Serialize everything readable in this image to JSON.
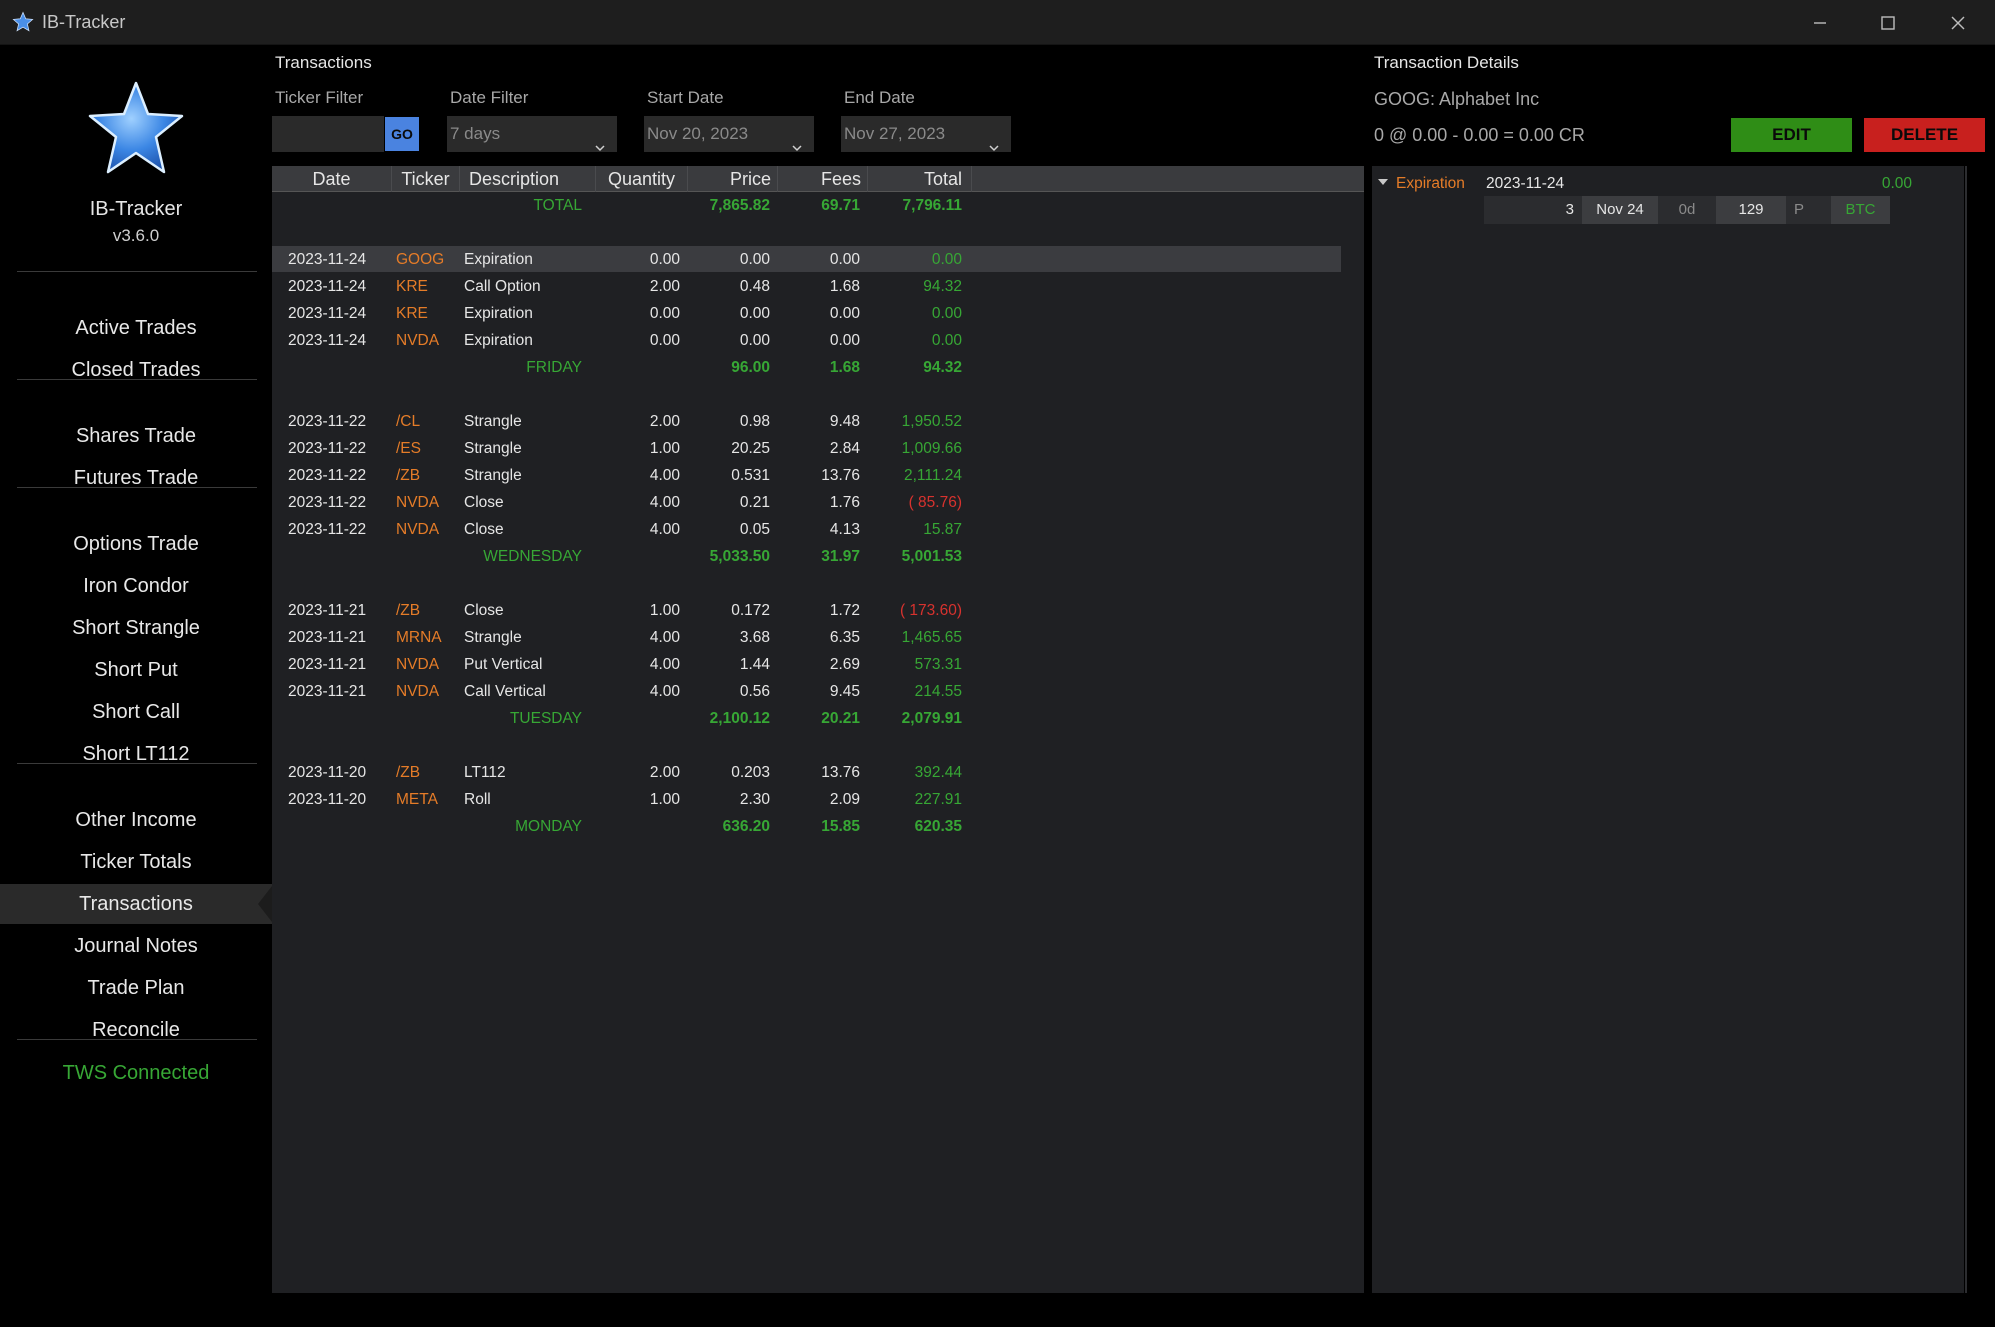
{
  "window": {
    "title": "IB-Tracker"
  },
  "sidebar": {
    "app_name": "IB-Tracker",
    "version": "v3.6.0",
    "groups": [
      [
        "Active Trades",
        "Closed Trades"
      ],
      [
        "Shares Trade",
        "Futures Trade"
      ],
      [
        "Options Trade",
        "Iron Condor",
        "Short Strangle",
        "Short Put",
        "Short Call",
        "Short LT112"
      ],
      [
        "Other Income",
        "Ticker Totals",
        "Transactions",
        "Journal Notes",
        "Trade Plan",
        "Reconcile"
      ]
    ],
    "active_item": "Transactions",
    "status": "TWS Connected"
  },
  "transactions": {
    "title": "Transactions",
    "ticker_filter": {
      "label": "Ticker Filter",
      "value": "",
      "go_label": "GO"
    },
    "date_filter": {
      "label": "Date Filter",
      "value": "7 days"
    },
    "start_date": {
      "label": "Start Date",
      "value": "Nov 20, 2023"
    },
    "end_date": {
      "label": "End Date",
      "value": "Nov 27, 2023"
    },
    "columns": [
      "Date",
      "Ticker",
      "Description",
      "Quantity",
      "Price",
      "Fees",
      "Total"
    ],
    "total_row": {
      "label": "TOTAL",
      "price": "7,865.82",
      "fees": "69.71",
      "total": "7,796.11"
    },
    "groups": [
      {
        "label": "FRIDAY",
        "price": "96.00",
        "fees": "1.68",
        "total": "94.32",
        "rows": [
          {
            "date": "2023-11-24",
            "ticker": "GOOG",
            "description": "Expiration",
            "quantity": "0.00",
            "price": "0.00",
            "fees": "0.00",
            "total": "0.00",
            "neg": false,
            "selected": true
          },
          {
            "date": "2023-11-24",
            "ticker": "KRE",
            "description": "Call Option",
            "quantity": "2.00",
            "price": "0.48",
            "fees": "1.68",
            "total": "94.32",
            "neg": false
          },
          {
            "date": "2023-11-24",
            "ticker": "KRE",
            "description": "Expiration",
            "quantity": "0.00",
            "price": "0.00",
            "fees": "0.00",
            "total": "0.00",
            "neg": false
          },
          {
            "date": "2023-11-24",
            "ticker": "NVDA",
            "description": "Expiration",
            "quantity": "0.00",
            "price": "0.00",
            "fees": "0.00",
            "total": "0.00",
            "neg": false
          }
        ]
      },
      {
        "label": "WEDNESDAY",
        "price": "5,033.50",
        "fees": "31.97",
        "total": "5,001.53",
        "rows": [
          {
            "date": "2023-11-22",
            "ticker": "/CL",
            "description": "Strangle",
            "quantity": "2.00",
            "price": "0.98",
            "fees": "9.48",
            "total": "1,950.52",
            "neg": false
          },
          {
            "date": "2023-11-22",
            "ticker": "/ES",
            "description": "Strangle",
            "quantity": "1.00",
            "price": "20.25",
            "fees": "2.84",
            "total": "1,009.66",
            "neg": false
          },
          {
            "date": "2023-11-22",
            "ticker": "/ZB",
            "description": "Strangle",
            "quantity": "4.00",
            "price": "0.531",
            "fees": "13.76",
            "total": "2,111.24",
            "neg": false
          },
          {
            "date": "2023-11-22",
            "ticker": "NVDA",
            "description": "Close",
            "quantity": "4.00",
            "price": "0.21",
            "fees": "1.76",
            "total": "( 85.76)",
            "neg": true
          },
          {
            "date": "2023-11-22",
            "ticker": "NVDA",
            "description": "Close",
            "quantity": "4.00",
            "price": "0.05",
            "fees": "4.13",
            "total": "15.87",
            "neg": false
          }
        ]
      },
      {
        "label": "TUESDAY",
        "price": "2,100.12",
        "fees": "20.21",
        "total": "2,079.91",
        "rows": [
          {
            "date": "2023-11-21",
            "ticker": "/ZB",
            "description": "Close",
            "quantity": "1.00",
            "price": "0.172",
            "fees": "1.72",
            "total": "( 173.60)",
            "neg": true
          },
          {
            "date": "2023-11-21",
            "ticker": "MRNA",
            "description": "Strangle",
            "quantity": "4.00",
            "price": "3.68",
            "fees": "6.35",
            "total": "1,465.65",
            "neg": false
          },
          {
            "date": "2023-11-21",
            "ticker": "NVDA",
            "description": "Put Vertical",
            "quantity": "4.00",
            "price": "1.44",
            "fees": "2.69",
            "total": "573.31",
            "neg": false
          },
          {
            "date": "2023-11-21",
            "ticker": "NVDA",
            "description": "Call Vertical",
            "quantity": "4.00",
            "price": "0.56",
            "fees": "9.45",
            "total": "214.55",
            "neg": false
          }
        ]
      },
      {
        "label": "MONDAY",
        "price": "636.20",
        "fees": "15.85",
        "total": "620.35",
        "rows": [
          {
            "date": "2023-11-20",
            "ticker": "/ZB",
            "description": "LT112",
            "quantity": "2.00",
            "price": "0.203",
            "fees": "13.76",
            "total": "392.44",
            "neg": false
          },
          {
            "date": "2023-11-20",
            "ticker": "META",
            "description": "Roll",
            "quantity": "1.00",
            "price": "2.30",
            "fees": "2.09",
            "total": "227.91",
            "neg": false
          }
        ]
      }
    ]
  },
  "details": {
    "title": "Transaction Details",
    "name": "GOOG: Alphabet Inc",
    "calc": "0 @ 0.00 - 0.00 = 0.00 CR",
    "edit_label": "EDIT",
    "delete_label": "DELETE",
    "entry": {
      "type": "Expiration",
      "date": "2023-11-24",
      "amount": "0.00"
    },
    "leg": {
      "quantity": "3",
      "expiry": "Nov 24",
      "dte": "0d",
      "strike": "129",
      "put_call": "P",
      "action": "BTC"
    }
  },
  "colors": {
    "accent_green": "#37a735",
    "ticker_orange": "#e57c28",
    "negative_red": "#d7322e",
    "go_blue": "#4a83e0",
    "edit_green": "#2f8d16",
    "delete_red": "#c8201e"
  }
}
